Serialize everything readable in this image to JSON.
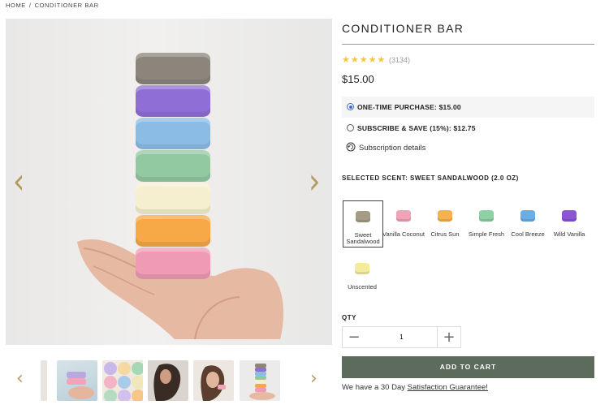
{
  "breadcrumb": {
    "home": "HOME",
    "separator": "/",
    "current": "CONDITIONER BAR"
  },
  "product": {
    "title": "CONDITIONER BAR",
    "rating_stars": "★★★★★",
    "review_count": "(3134)",
    "price": "$15.00"
  },
  "purchase_options": [
    {
      "label": "ONE-TIME PURCHASE: $15.00",
      "selected": true
    },
    {
      "label": "SUBSCRIBE & SAVE (15%): $12.75",
      "selected": false
    }
  ],
  "subscription_details": "Subscription details",
  "scent": {
    "selected_label": "SELECTED SCENT: SWEET SANDALWOOD (2.0 OZ)",
    "options": [
      {
        "name": "Sweet Sandalwood",
        "color": "#a59c86",
        "selected": true
      },
      {
        "name": "Vanilla Coconut",
        "color": "#f2a3b8",
        "selected": false
      },
      {
        "name": "Citrus Sun",
        "color": "#f6b24e",
        "selected": false
      },
      {
        "name": "Simple Fresh",
        "color": "#8fd0a6",
        "selected": false
      },
      {
        "name": "Cool Breeze",
        "color": "#6aaee6",
        "selected": false
      },
      {
        "name": "Wild Vanilla",
        "color": "#8a55d6",
        "selected": false
      },
      {
        "name": "Unscented",
        "color": "#f4ec9a",
        "selected": false
      }
    ]
  },
  "quantity": {
    "label": "QTY",
    "value": "1",
    "minus": "−",
    "plus": "+"
  },
  "add_to_cart": "ADD TO CART",
  "guarantee": {
    "prefix": "We have a 30 Day ",
    "link": "Satisfaction Guarantee!"
  },
  "gallery": {
    "prev_arrow": "‹",
    "next_arrow": "›",
    "bar_colors": [
      "#8b857c",
      "#8f6fd6",
      "#8bbce6",
      "#93c9a1",
      "#f6efcf",
      "#f7a948",
      "#ef9bb6"
    ]
  }
}
